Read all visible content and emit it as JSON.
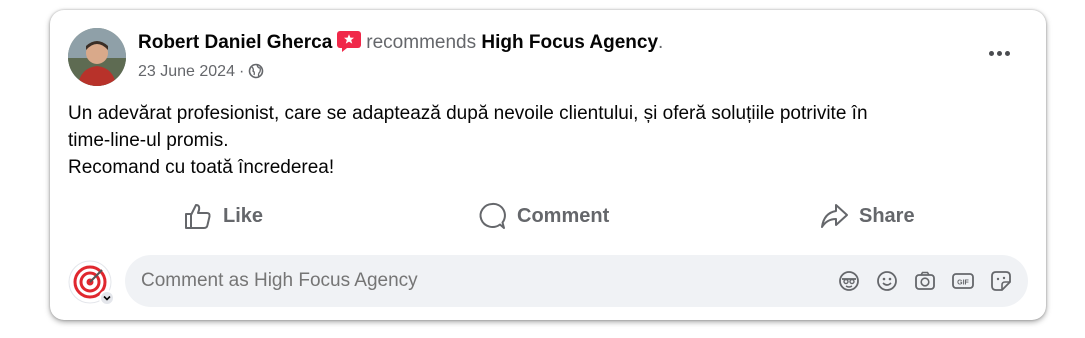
{
  "post": {
    "author": "Robert Daniel Gherca",
    "verb": "recommends",
    "page": "High Focus Agency",
    "period": ".",
    "date": "23 June 2024",
    "separator": "·",
    "privacy_icon": "globe-icon",
    "body_lines": [
      "Un adevărat profesionist, care se adaptează după nevoile clientului, și oferă soluțiile potrivite în",
      "time-line-ul promis.",
      "Recomand cu toată încrederea!"
    ]
  },
  "actions": {
    "like": "Like",
    "comment": "Comment",
    "share": "Share"
  },
  "composer": {
    "placeholder": "Comment as High Focus Agency",
    "tools": [
      "avatar-sticker-icon",
      "emoji-icon",
      "camera-icon",
      "gif-icon",
      "sticker-icon"
    ]
  },
  "colors": {
    "recommend_badge": "#f02849",
    "text_primary": "#050505",
    "text_secondary": "#65676b",
    "composer_bg": "#f0f2f5",
    "brand_red": "#e0272e"
  }
}
